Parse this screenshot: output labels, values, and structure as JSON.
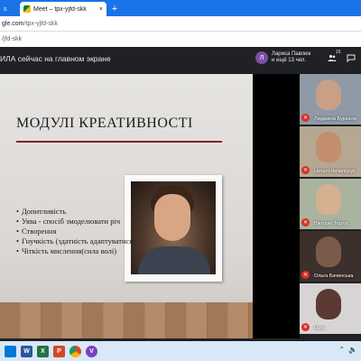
{
  "browser": {
    "tabs": [
      {
        "label": "s",
        "active": false
      },
      {
        "label": "Meet – tpx-yjfd-skk",
        "active": true
      }
    ],
    "close_glyph": "×",
    "new_tab_glyph": "+",
    "address": {
      "host": "gle.com",
      "path": "/tpx-yjfd-skk"
    },
    "bookmarks_text": "/jfd-skk"
  },
  "meet": {
    "presenting_text": "ИЛА сейчас на главном экране",
    "host": {
      "initial": "Л",
      "name_line1": "Лариса Павлюк",
      "name_line2": "и ещё 13 чел."
    },
    "people_count": "15",
    "icons": {
      "people": "people-icon",
      "chat": "chat-icon"
    }
  },
  "slide": {
    "title": "МОДУЛІ КРЕАТИВНОСТІ",
    "bullets": [
      "Допитливість",
      "Уява - спосіб змоделювати річ",
      "Створення",
      "Гнучкість (здатність адаптуватися",
      "Чіткість мислення(сила волі)"
    ]
  },
  "participants": [
    {
      "name": "Людмила Бурхала",
      "muted": true,
      "bg": "#8f9aa6",
      "skin": "#c99f86"
    },
    {
      "name": "Наталі Нечипорук",
      "muted": true,
      "bg": "#b5a792",
      "skin": "#c28e6e"
    },
    {
      "name": "Вікторія Тертус",
      "muted": true,
      "bg": "#a9b3a0",
      "skin": "#d6b08f"
    },
    {
      "name": "Ольга Бачинська",
      "muted": true,
      "bg": "#3b302c",
      "skin": "#7a5a4b"
    },
    {
      "name": "Ната",
      "muted": true,
      "bg": "#d8d4d6",
      "skin": "#5a3a32"
    }
  ],
  "taskbar": {
    "apps": [
      {
        "label": "",
        "color": "#0078d7",
        "icon": "windows-icon"
      },
      {
        "label": "W",
        "color": "#2b579a",
        "icon": "word-icon"
      },
      {
        "label": "X",
        "color": "#217346",
        "icon": "excel-icon"
      },
      {
        "label": "P",
        "color": "#d24726",
        "icon": "powerpoint-icon"
      },
      {
        "label": "●",
        "color": "#f2b400",
        "icon": "chrome-icon"
      },
      {
        "label": "V",
        "color": "#7a3fbf",
        "icon": "viber-icon"
      }
    ],
    "tray": [
      "⌃",
      "🔈"
    ]
  }
}
